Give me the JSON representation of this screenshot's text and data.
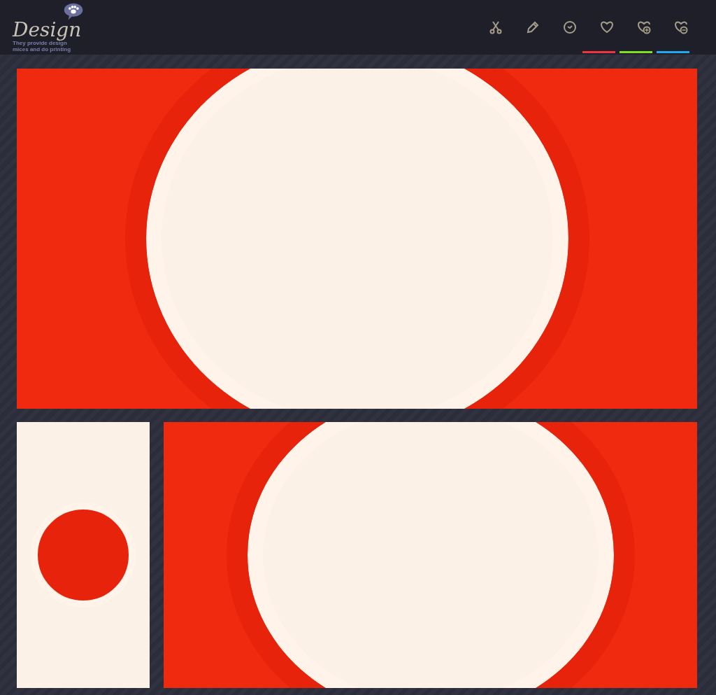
{
  "logo": {
    "wordmark": "Design",
    "tagline": [
      "They provide design",
      "mices and do printing"
    ]
  },
  "toolbar": [
    {
      "kind": "scissors"
    },
    {
      "kind": "pencil"
    },
    {
      "kind": "clock"
    },
    {
      "kind": "heart",
      "color": "#ef3340"
    },
    {
      "kind": "heart-plus",
      "color": "#7ee021"
    },
    {
      "kind": "heart-minus",
      "color": "#23a7ef"
    }
  ]
}
